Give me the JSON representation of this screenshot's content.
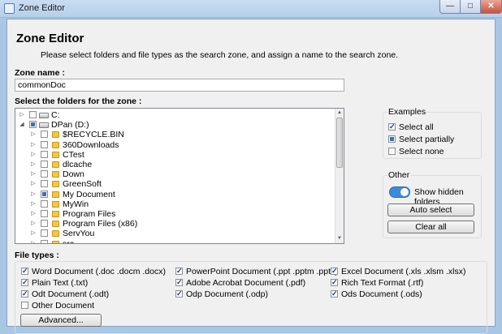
{
  "window": {
    "title": "Zone Editor",
    "min_glyph": "—",
    "max_glyph": "□",
    "close_glyph": "✕"
  },
  "header": {
    "heading": "Zone Editor",
    "description": "Please select folders and file types as the search zone, and assign a name to the search zone."
  },
  "zone_name": {
    "label": "Zone name :",
    "value": "commonDoc"
  },
  "folders": {
    "label": "Select the folders for the zone :",
    "nodes": [
      {
        "name": "C:",
        "type": "drive",
        "expander": "▷",
        "check": "unchecked",
        "level": 0
      },
      {
        "name": "DPan (D:)",
        "type": "drive",
        "expander": "◢",
        "check": "partial",
        "level": 0
      },
      {
        "name": "$RECYCLE.BIN",
        "type": "folder",
        "expander": "▷",
        "check": "unchecked",
        "level": 1
      },
      {
        "name": "360Downloads",
        "type": "folder",
        "expander": "▷",
        "check": "unchecked",
        "level": 1
      },
      {
        "name": "CTest",
        "type": "folder",
        "expander": "▷",
        "check": "unchecked",
        "level": 1
      },
      {
        "name": "dlcache",
        "type": "folder",
        "expander": "▷",
        "check": "unchecked",
        "level": 1
      },
      {
        "name": "Down",
        "type": "folder",
        "expander": "▷",
        "check": "unchecked",
        "level": 1
      },
      {
        "name": "GreenSoft",
        "type": "folder",
        "expander": "▷",
        "check": "unchecked",
        "level": 1
      },
      {
        "name": "My Document",
        "type": "folder",
        "expander": "▷",
        "check": "partial",
        "level": 1
      },
      {
        "name": "MyWin",
        "type": "folder",
        "expander": "▷",
        "check": "unchecked",
        "level": 1
      },
      {
        "name": "Program Files",
        "type": "folder",
        "expander": "▷",
        "check": "unchecked",
        "level": 1
      },
      {
        "name": "Program Files (x86)",
        "type": "folder",
        "expander": "▷",
        "check": "unchecked",
        "level": 1
      },
      {
        "name": "ServYou",
        "type": "folder",
        "expander": "▷",
        "check": "unchecked",
        "level": 1
      },
      {
        "name": "src",
        "type": "folder",
        "expander": "▷",
        "check": "unchecked",
        "level": 1
      }
    ],
    "scroll_up_glyph": "▲",
    "scroll_down_glyph": "▼"
  },
  "examples": {
    "title": "Examples",
    "items": [
      {
        "label": "Select all",
        "check": "checked"
      },
      {
        "label": "Select partially",
        "check": "partial"
      },
      {
        "label": "Select none",
        "check": "unchecked"
      }
    ]
  },
  "other": {
    "title": "Other",
    "toggle_label": "Show hidden folders",
    "toggle_on": true,
    "auto_select_label": "Auto select",
    "clear_all_label": "Clear all"
  },
  "file_types": {
    "label": "File types :",
    "items": [
      {
        "label": "Word Document (.doc .docm .docx)",
        "checked": true
      },
      {
        "label": "PowerPoint Document (.ppt .pptm .pptx)",
        "checked": true
      },
      {
        "label": "Excel Document (.xls .xlsm .xlsx)",
        "checked": true
      },
      {
        "label": "Plain Text (.txt)",
        "checked": true
      },
      {
        "label": "Adobe Acrobat Document (.pdf)",
        "checked": true
      },
      {
        "label": "Rich Text Format (.rtf)",
        "checked": true
      },
      {
        "label": "Odt Document (.odt)",
        "checked": true
      },
      {
        "label": "Odp Document (.odp)",
        "checked": true
      },
      {
        "label": "Ods Document (.ods)",
        "checked": true
      },
      {
        "label": "Other Document",
        "checked": false
      }
    ],
    "advanced_label": "Advanced..."
  },
  "colors": {
    "accent": "#3d8ad6",
    "folder": "#f2c745",
    "window_frame": "#a9c6e4"
  }
}
